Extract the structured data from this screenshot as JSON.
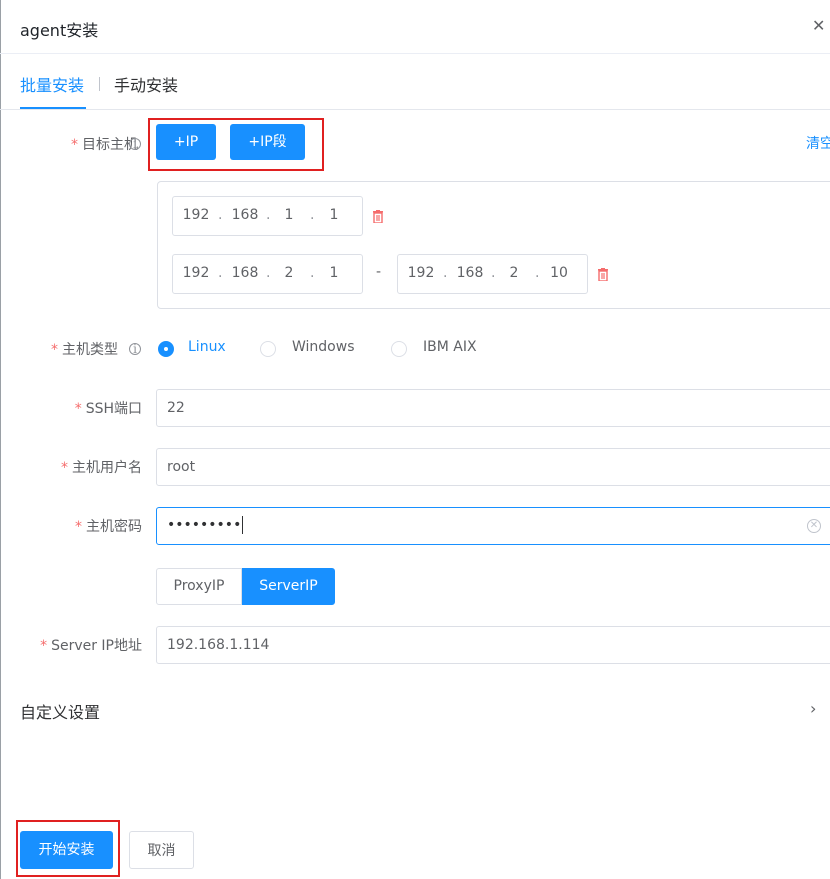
{
  "dialog": {
    "title": "agent安装",
    "close_icon": "close-icon"
  },
  "tabs": [
    {
      "label": "批量安装",
      "active": true
    },
    {
      "label": "手动安装",
      "active": false
    }
  ],
  "form": {
    "target_host": {
      "label": "目标主机",
      "add_ip_label": "+IP",
      "add_ip_range_label": "+IP段",
      "clear_label": "清空",
      "single_ip": [
        "192",
        "168",
        "1",
        "1"
      ],
      "range_start": [
        "192",
        "168",
        "2",
        "1"
      ],
      "range_end": [
        "192",
        "168",
        "2",
        "10"
      ],
      "range_separator": "-"
    },
    "host_type": {
      "label": "主机类型",
      "options": [
        "Linux",
        "Windows",
        "IBM AIX"
      ],
      "selected": "Linux"
    },
    "ssh_port": {
      "label": "SSH端口",
      "value": "22"
    },
    "host_user": {
      "label": "主机用户名",
      "value": "root"
    },
    "host_password": {
      "label": "主机密码",
      "masked_value": "•••••••••"
    },
    "ip_mode": {
      "options": [
        "ProxyIP",
        "ServerIP"
      ],
      "selected": "ServerIP"
    },
    "server_ip": {
      "label": "Server IP地址",
      "value": "192.168.1.114"
    }
  },
  "custom_settings": {
    "label": "自定义设置"
  },
  "footer": {
    "start_label": "开始安装",
    "cancel_label": "取消"
  },
  "colors": {
    "primary": "#1890ff",
    "required": "#f56c6c",
    "highlight_box": "#e02020",
    "delete": "#f56c6c"
  }
}
